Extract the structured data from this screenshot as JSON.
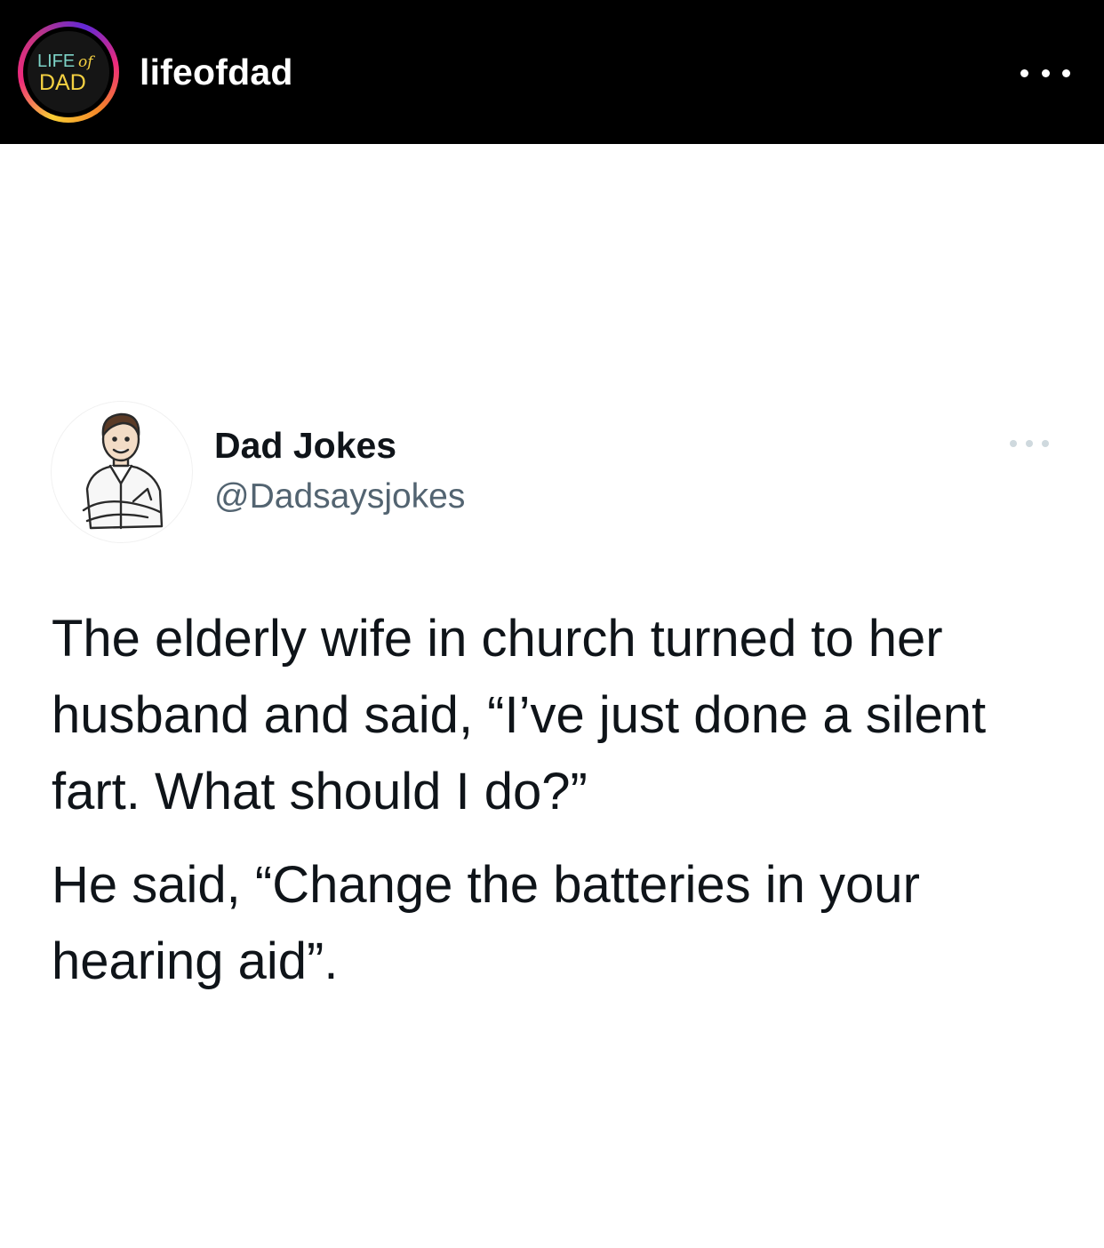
{
  "post_header": {
    "username": "lifeofdad",
    "avatar_logo_text": [
      "LIFE",
      "of",
      "DAD"
    ],
    "more_icon": "more-horizontal-icon"
  },
  "tweet": {
    "display_name": "Dad Jokes",
    "handle": "@Dadsaysjokes",
    "more_icon": "more-horizontal-icon",
    "paragraphs": [
      "The elderly wife in church turned to her husband and said, “I’ve just done a silent fart. What should I do?”",
      "He said, “Change the batteries in your hearing aid”."
    ]
  },
  "colors": {
    "header_bg": "#000000",
    "tweet_text": "#0f1419",
    "handle_text": "#536471"
  }
}
